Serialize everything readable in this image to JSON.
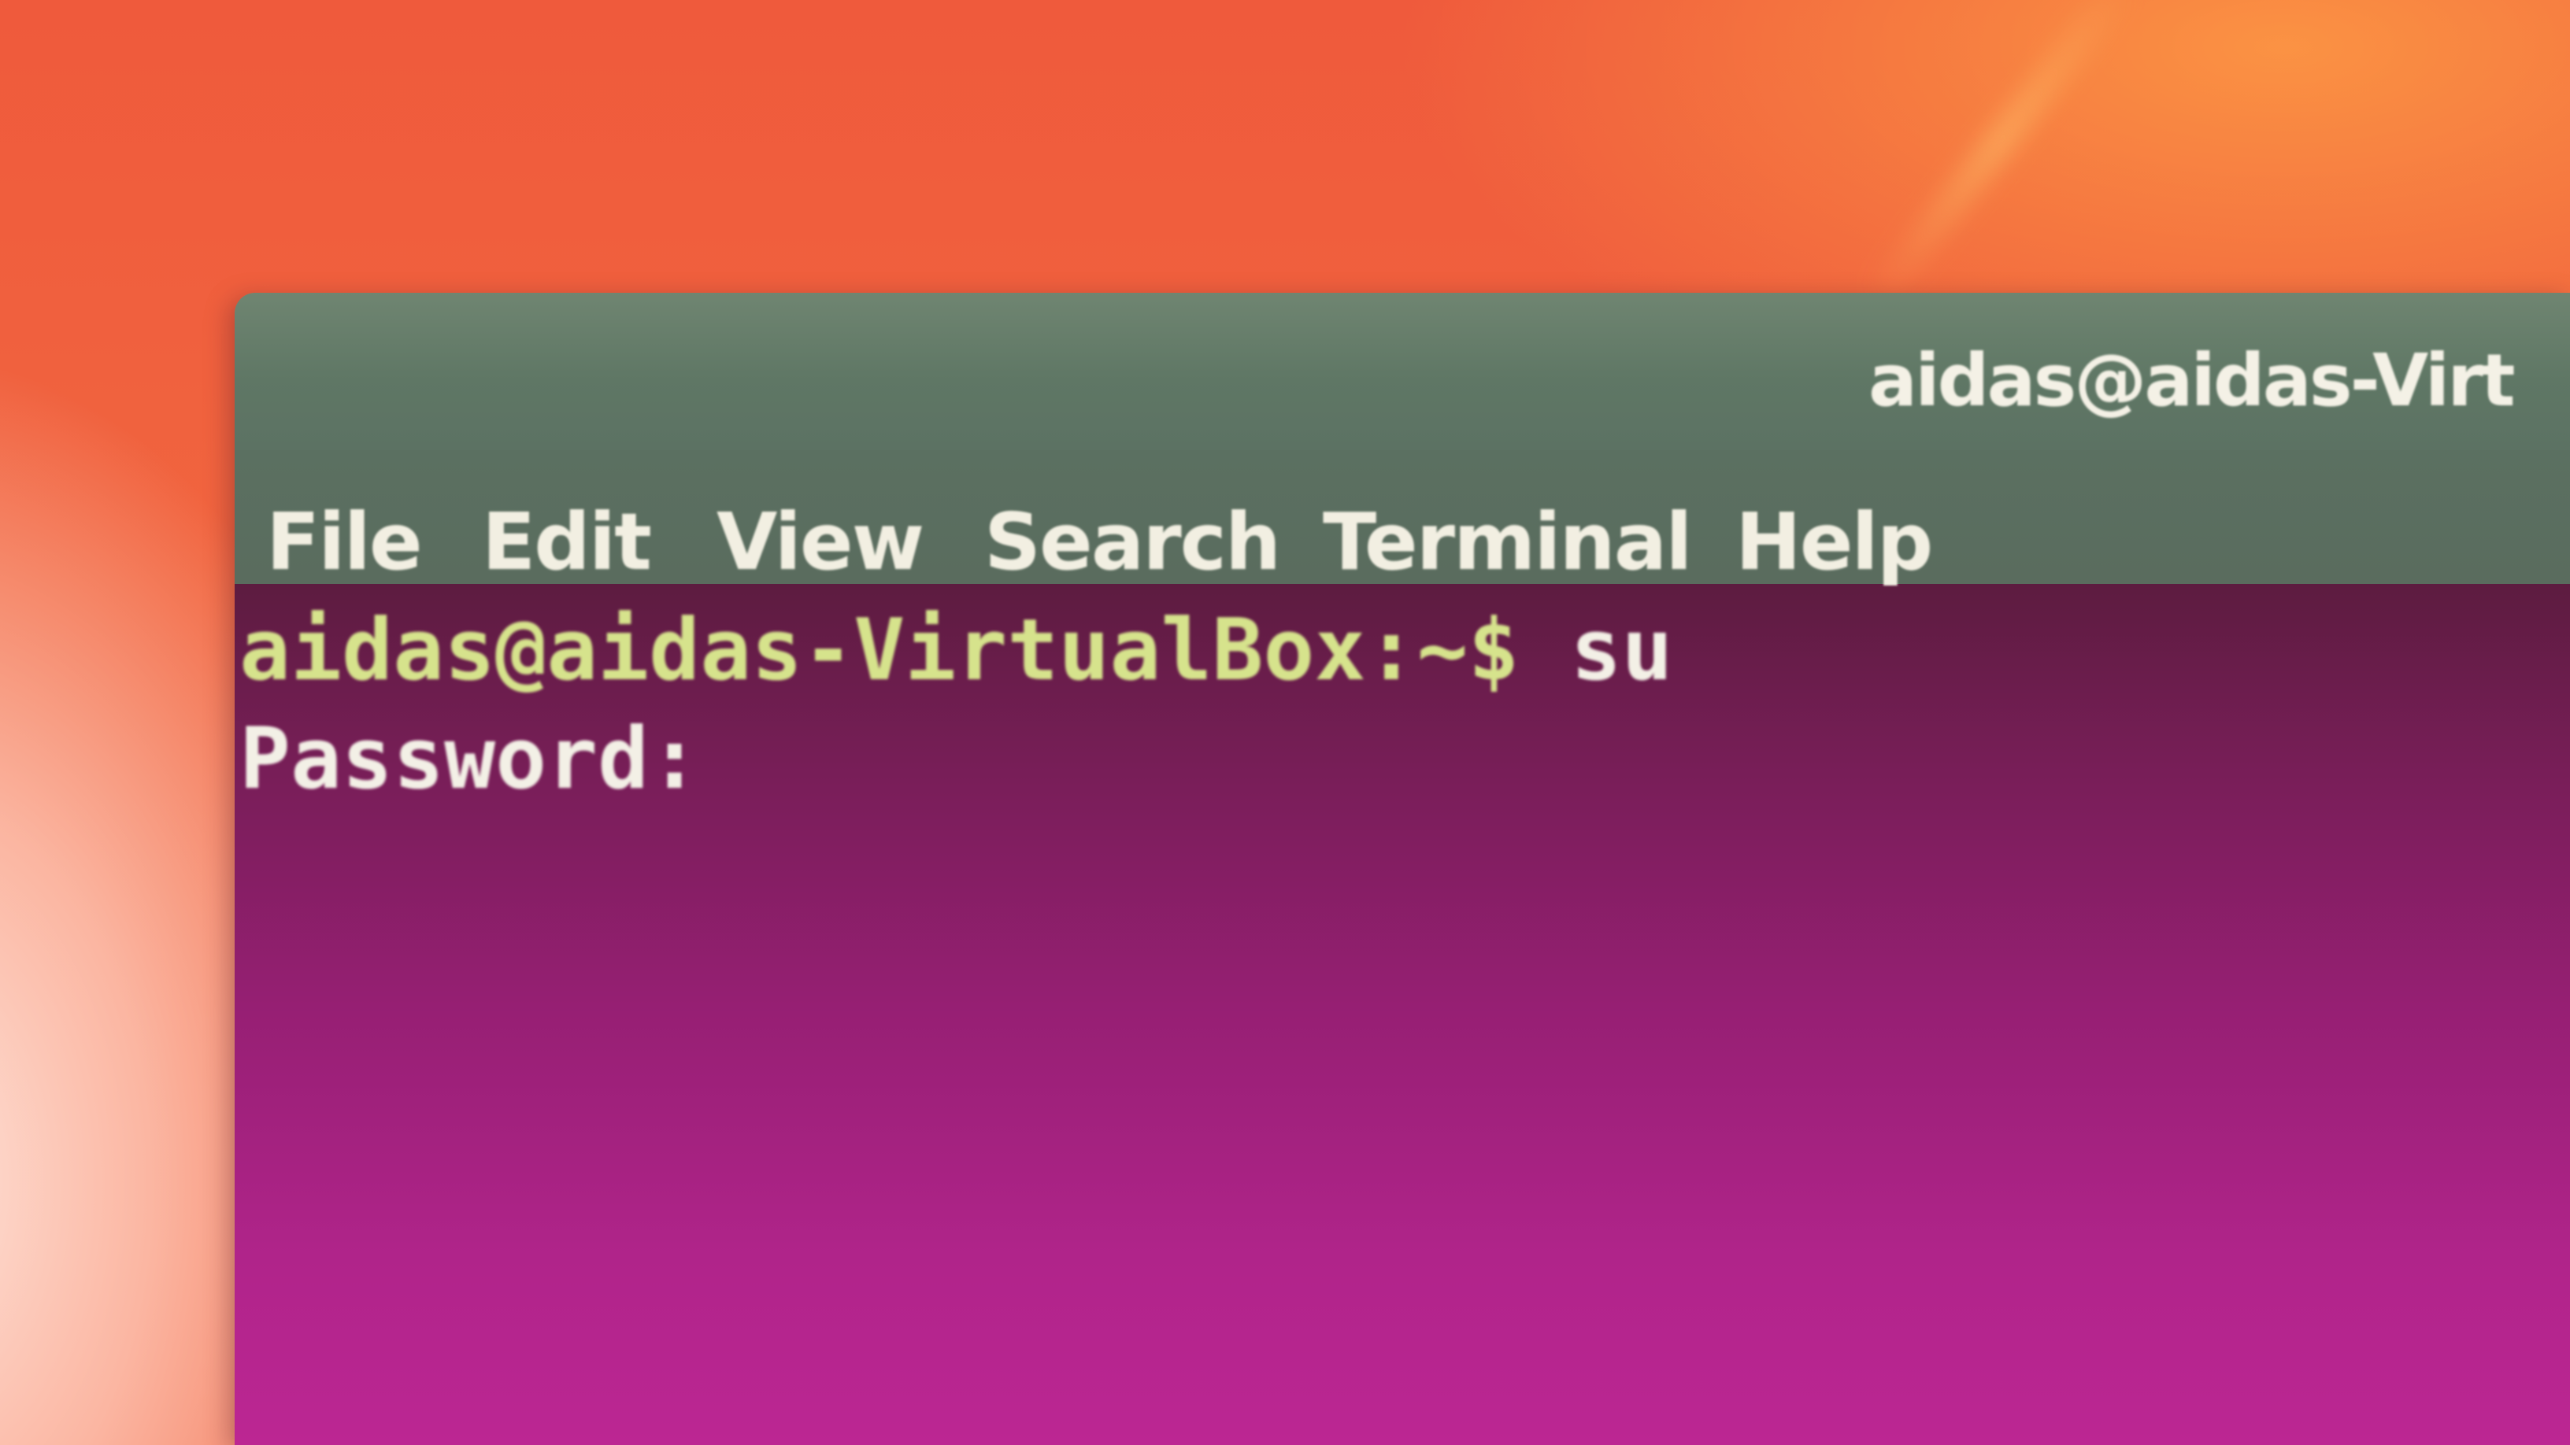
{
  "window": {
    "title": "aidas@aidas-Virt"
  },
  "menu": {
    "items": [
      {
        "label": "File"
      },
      {
        "label": "Edit"
      },
      {
        "label": "View"
      },
      {
        "label": "Search"
      },
      {
        "label": "Terminal"
      },
      {
        "label": "Help"
      }
    ]
  },
  "terminal": {
    "lines": [
      {
        "prompt": "aidas@aidas-VirtualBox:~$",
        "command": " su"
      },
      {
        "text": "Password:"
      }
    ]
  },
  "colors": {
    "title_bar": "#5f7765",
    "terminal_background": "#971f74",
    "prompt_text": "#d6e38c",
    "output_text": "#f3f0e6",
    "desktop_wallpaper": "#ef5a3c"
  }
}
